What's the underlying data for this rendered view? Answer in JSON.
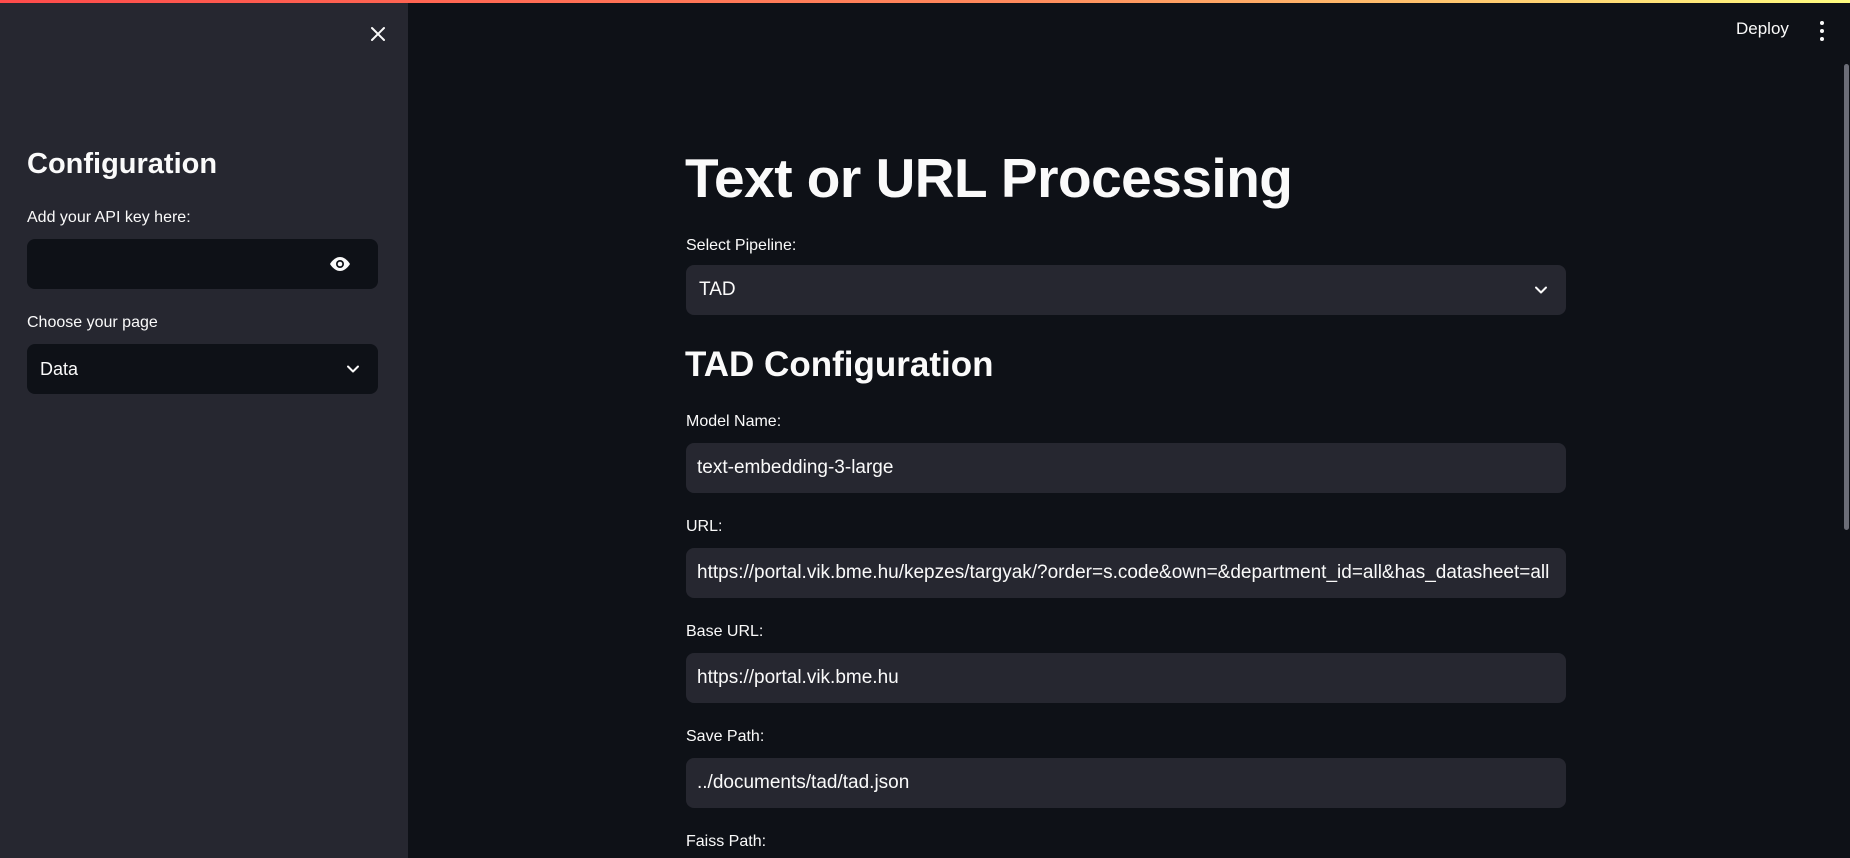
{
  "sidebar": {
    "title": "Configuration",
    "api_key_label": "Add your API key here:",
    "api_key_value": "",
    "page_label": "Choose your page",
    "page_value": "Data"
  },
  "header": {
    "deploy_label": "Deploy"
  },
  "main": {
    "title": "Text or URL Processing",
    "pipeline_label": "Select Pipeline:",
    "pipeline_value": "TAD",
    "section_title": "TAD Configuration",
    "model_label": "Model Name:",
    "model_value": "text-embedding-3-large",
    "url_label": "URL:",
    "url_value": "https://portal.vik.bme.hu/kepzes/targyak/?order=s.code&own=&department_id=all&has_datasheet=all",
    "base_url_label": "Base URL:",
    "base_url_value": "https://portal.vik.bme.hu",
    "save_path_label": "Save Path:",
    "save_path_value": "../documents/tad/tad.json",
    "faiss_path_label": "Faiss Path:"
  },
  "colors": {
    "sidebar_bg": "#262730",
    "main_bg": "#0e1117",
    "input_bg": "#262730",
    "accent_gradient_start": "#ff4b4b",
    "accent_gradient_end": "#fffd80"
  },
  "icons": [
    "close-icon",
    "eye-icon",
    "chevron-down-icon",
    "more-vertical-icon"
  ]
}
